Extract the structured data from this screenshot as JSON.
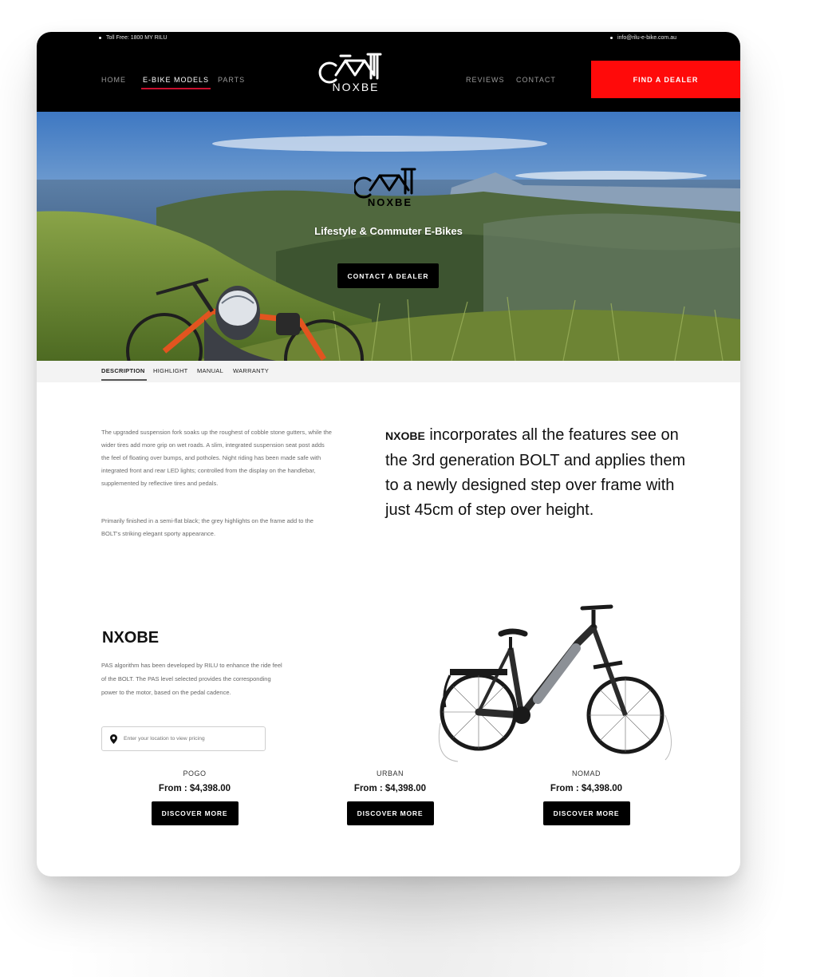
{
  "header": {
    "toll_free": "Toll Free: 1800 MY RILU",
    "email": "info@rilu-e-bike.com.au",
    "nav": [
      "HOME",
      "E-BIKE MODELS",
      "PARTS",
      "REVIEWS",
      "CONTACT"
    ],
    "active_nav": "E-BIKE MODELS",
    "logo_text": "NOXBE",
    "cta": "FIND A DEALER",
    "cta_color": "#ff0a0a"
  },
  "hero": {
    "logo_text": "NOXBE",
    "tagline": "Lifestyle & Commuter E-Bikes",
    "button": "CONTACT A DEALER"
  },
  "tabs": {
    "items": [
      "DESCRIPTION",
      "HIGHLIGHT",
      "MANUAL",
      "WARRANTY"
    ],
    "active": "DESCRIPTION"
  },
  "description": {
    "paragraph1": "The upgraded suspension fork soaks up the roughest of cobble stone gutters, while the wider tires add more grip on wet roads. A slim, integrated suspension seat post adds the feel of floating over bumps, and potholes. Night riding has been made safe with integrated front and rear LED lights; controlled from the display on the handlebar, supplemented by reflective tires and pedals.",
    "paragraph2": "Primarily finished in a semi-flat black; the grey highlights on the frame add to the BOLT's striking elegant sporty appearance.",
    "feature_brand": "NXOBE",
    "feature_text": " incorporates all the features see on the 3rd generation BOLT and applies them to a newly designed step over frame with just 45cm of step over height."
  },
  "product": {
    "title": "NXOBE",
    "text": "PAS algorithm has been developed by RILU to enhance the ride feel of the BOLT. The PAS level selected provides the corresponding power to the motor, based on the pedal cadence.",
    "location_placeholder": "Enter your location to view pricing",
    "location_icon": "map-pin-icon",
    "models": [
      {
        "name": "POGO",
        "price": "From : $4,398.00",
        "button": "DISCOVER MORE"
      },
      {
        "name": "URBAN",
        "price": "From : $4,398.00",
        "button": "DISCOVER MORE"
      },
      {
        "name": "NOMAD",
        "price": "From : $4,398.00",
        "button": "DISCOVER MORE"
      }
    ]
  }
}
